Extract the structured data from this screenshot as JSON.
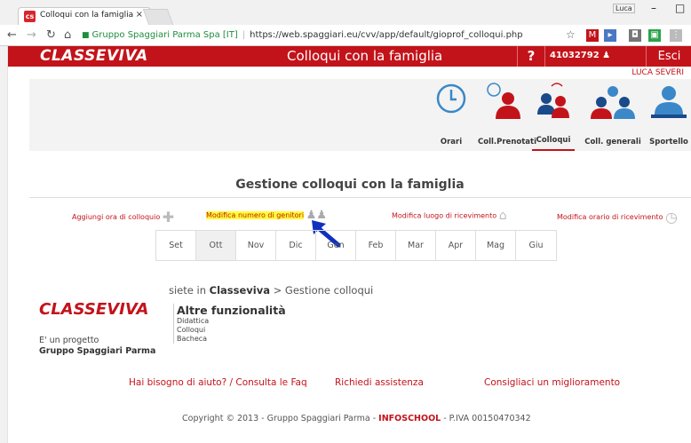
{
  "browser": {
    "tab_title": "Colloqui con la famiglia",
    "tab_close": "×",
    "user_badge": "Luca",
    "window_controls": [
      "–",
      "□"
    ],
    "org": "Gruppo Spaggiari Parma Spa [IT]",
    "url": "https://web.spaggiari.eu/cvv/app/default/gioprof_colloqui.php"
  },
  "header": {
    "logo": "CLASSEVIVA",
    "title": "Colloqui con la famiglia",
    "help": "?",
    "user_code": "41032792",
    "logout": "Esci",
    "user_name": "LUCA SEVERI"
  },
  "menu": [
    {
      "label": "Orari",
      "icon": "clock-icon"
    },
    {
      "label": "Coll.Prenotati",
      "icon": "booked-meetings-icon"
    },
    {
      "label": "Colloqui",
      "icon": "meetings-icon",
      "active": true
    },
    {
      "label": "Coll. generali",
      "icon": "general-meetings-icon"
    },
    {
      "label": "Sportello",
      "icon": "desk-icon"
    }
  ],
  "page_heading": "Gestione colloqui con la famiglia",
  "actions": {
    "add_hour": "Aggiungi ora di colloquio",
    "edit_parents": "Modifica numero di genitori",
    "edit_place": "Modifica luogo di ricevimento",
    "edit_time": "Modifica orario di ricevimento"
  },
  "months": [
    "Set",
    "Ott",
    "Nov",
    "Dic",
    "Gen",
    "Feb",
    "Mar",
    "Apr",
    "Mag",
    "Giu"
  ],
  "selected_month": "Ott",
  "breadcrumb": {
    "prefix": "siete in ",
    "root": "Classeviva",
    "rest": " > Gestione colloqui"
  },
  "footer_logo": "CLASSEVIVA",
  "project": {
    "line1": "E' un progetto",
    "line2": "Gruppo Spaggiari Parma"
  },
  "other": {
    "title": "Altre funzionalità",
    "items": [
      "Didattica",
      "Colloqui",
      "Bacheca"
    ]
  },
  "links": {
    "help": "Hai bisogno di aiuto? / Consulta le Faq",
    "assist": "Richiedi assistenza",
    "improve": "Consigliaci un miglioramento"
  },
  "copyright": {
    "pre": "Copyright © 2013 - Gruppo Spaggiari Parma - ",
    "brand": "INFOSCHOOL",
    "post": " - P.IVA 00150470342"
  },
  "colors": {
    "brand": "#c3131a",
    "highlight": "#ffff33",
    "annotation": "#1030c0"
  }
}
